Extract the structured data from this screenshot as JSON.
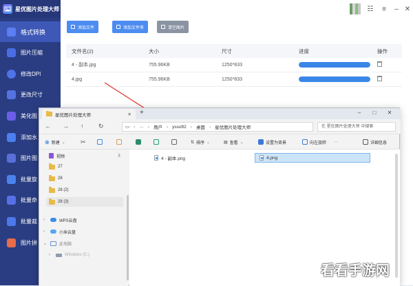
{
  "app": {
    "title": "星优图片处理大师",
    "nav": [
      {
        "label": "格式转换",
        "icon": "convert-icon",
        "active": true
      },
      {
        "label": "图片压缩",
        "icon": "compress-icon"
      },
      {
        "label": "修改DPI",
        "icon": "dpi-icon"
      },
      {
        "label": "更改尺寸",
        "icon": "resize-icon"
      },
      {
        "label": "美化图",
        "icon": "beautify-icon"
      },
      {
        "label": "添加水",
        "icon": "watermark-icon"
      },
      {
        "label": "图片图",
        "icon": "image-icon"
      },
      {
        "label": "批量旋",
        "icon": "rotate-icon"
      },
      {
        "label": "批量命",
        "icon": "rename-icon"
      },
      {
        "label": "批量裁",
        "icon": "crop-icon"
      },
      {
        "label": "图片拼",
        "icon": "stitch-icon"
      }
    ],
    "toolbar": {
      "add_file": "添加文件",
      "add_folder": "添加文件夹",
      "clear": "清空图片"
    },
    "table": {
      "headers": [
        "文件名(2)",
        "大小",
        "尺寸",
        "进度",
        "操作"
      ],
      "rows": [
        {
          "name": "4 - 副本.jpg",
          "size": "755.96KB",
          "dims": "1250*833",
          "progress": 1.0
        },
        {
          "name": "4.jpg",
          "size": "755.96KB",
          "dims": "1250*833",
          "progress": 1.0
        }
      ]
    },
    "colors": {
      "sidebar": "#2a3d82",
      "accent": "#4d8cf0",
      "progress": "#3a86e8"
    }
  },
  "explorer": {
    "tab_title": "星优图片处理大师",
    "new_tab": "+",
    "breadcrumb": [
      "用户",
      "yssoft2",
      "桌面",
      "星优图片处理大师"
    ],
    "search_placeholder": "在 星优图片处理大师 中搜索",
    "commands": {
      "new": "新建",
      "sort": "排序",
      "view": "查看",
      "set_wallpaper": "设置为背景",
      "rotate_right": "向左旋转",
      "details": "详细信息"
    },
    "sidebar": [
      {
        "label": "视频",
        "icon": "video-icon"
      },
      {
        "label": "27",
        "icon": "folder-icon"
      },
      {
        "label": "28",
        "icon": "folder-icon"
      },
      {
        "label": "28 (2)",
        "icon": "folder-icon"
      },
      {
        "label": "28 (3)",
        "icon": "folder-icon",
        "selected": true
      },
      {
        "label": "WPS云盘",
        "icon": "cloud-icon"
      },
      {
        "label": "小米云盘",
        "icon": "cloud-icon"
      },
      {
        "label": "此电脑",
        "icon": "pc-icon"
      },
      {
        "label": "Windows (C:)",
        "icon": "drive-icon"
      }
    ],
    "files": [
      {
        "name": "4 - 副本.png",
        "selected": false
      },
      {
        "name": "4.png",
        "selected": true
      }
    ]
  },
  "watermark": "看看手游网"
}
